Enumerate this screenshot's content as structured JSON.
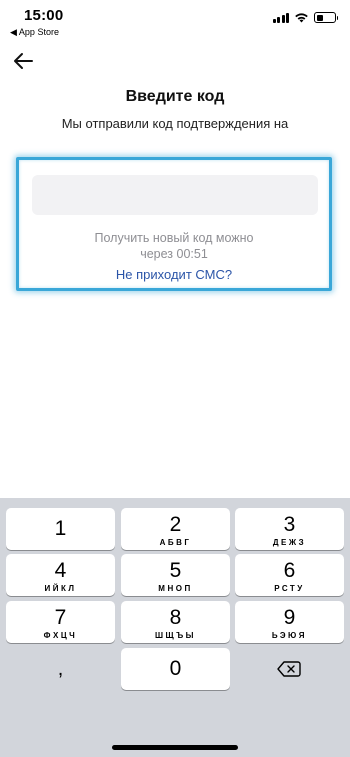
{
  "status_bar": {
    "time": "15:00",
    "back_app": "◀ App Store"
  },
  "header": {
    "title": "Введите код",
    "subtitle": "Мы отправили код подтверждения на"
  },
  "code": {
    "value": "",
    "placeholder": ""
  },
  "resend": {
    "line1": "Получить новый код можно",
    "line2": "через 00:51"
  },
  "no_sms_link": "Не приходит СМС?",
  "keypad": {
    "keys": [
      {
        "num": "1",
        "letters": ""
      },
      {
        "num": "2",
        "letters": "АБВГ"
      },
      {
        "num": "3",
        "letters": "ДЕЖЗ"
      },
      {
        "num": "4",
        "letters": "ИЙКЛ"
      },
      {
        "num": "5",
        "letters": "МНОП"
      },
      {
        "num": "6",
        "letters": "РСТУ"
      },
      {
        "num": "7",
        "letters": "ФХЦЧ"
      },
      {
        "num": "8",
        "letters": "ШЩЪЫ"
      },
      {
        "num": "9",
        "letters": "ЬЭЮЯ"
      }
    ],
    "comma": ",",
    "zero": "0"
  },
  "colors": {
    "accent_border": "#3aa7d8",
    "link": "#2b55a8",
    "keyboard_bg": "#d2d5db"
  },
  "icons": [
    "wifi-icon",
    "signal-icon",
    "battery-icon",
    "back-arrow-icon",
    "delete-key-icon"
  ]
}
